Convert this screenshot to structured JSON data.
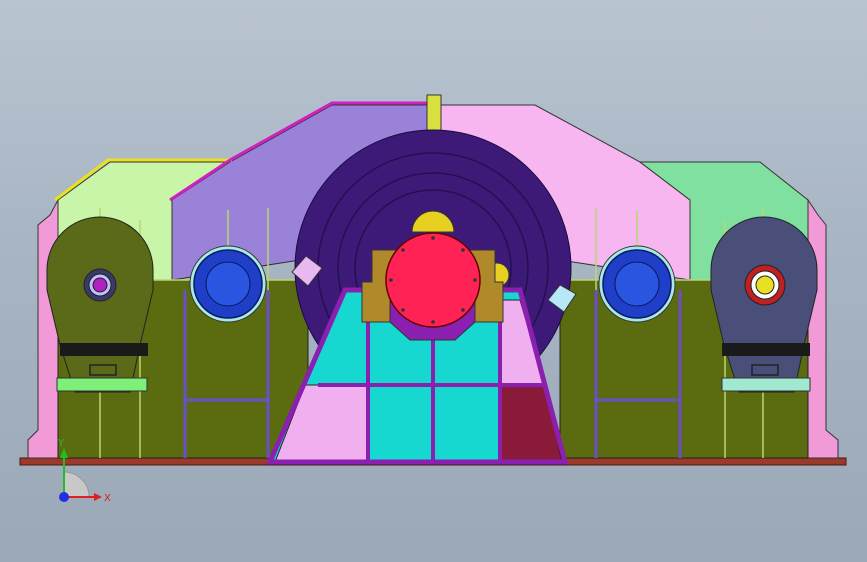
{
  "viewport": {
    "background_top": "#b9c4d0",
    "background_bottom": "#9aa8b8"
  },
  "model": {
    "colors": {
      "base_plate": "#9b3a2a",
      "frame_olive": "#5b6b0f",
      "housing_violet": "#9a82d8",
      "housing_pink": "#f8b6f0",
      "housing_green": "#c8f5a8",
      "housing_mint": "#7fe0a0",
      "drum_dark": "#3d1a78",
      "stand_cyan": "#17d8d0",
      "stand_purple": "#8a1fb0",
      "hub_red": "#ff2255",
      "hub_gold": "#b08a2a",
      "bearing_blue": "#1f3fc8",
      "bracket_olive": "#5a6a18",
      "bracket_slate": "#4a4f7a",
      "pad_green": "#7ef07a",
      "maroon_block": "#8a1a3a"
    }
  },
  "triad": {
    "x_label": "X",
    "y_label": "Y",
    "x_color": "#e02020",
    "y_color": "#20c020",
    "origin_color": "#2030e0"
  }
}
